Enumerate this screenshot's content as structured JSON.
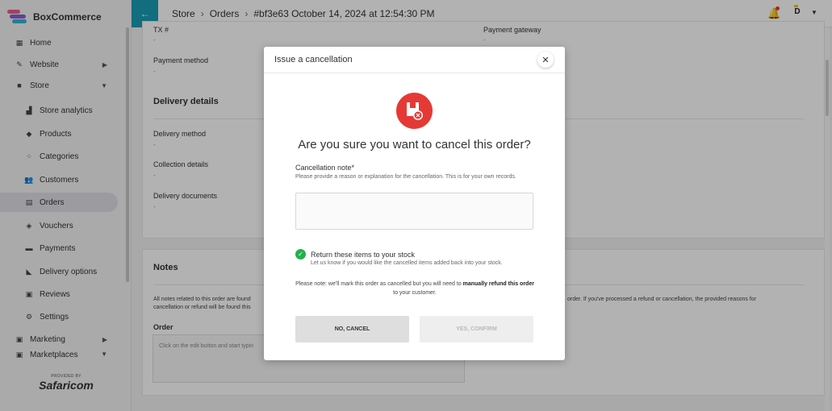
{
  "app": {
    "brand": "BoxCommerce"
  },
  "sidebar": {
    "items": [
      {
        "label": "Home",
        "icon": "grid-icon"
      },
      {
        "label": "Website",
        "icon": "pen-icon"
      },
      {
        "label": "Store",
        "icon": "bag-icon"
      },
      {
        "label": "Store analytics",
        "icon": "chart-icon"
      },
      {
        "label": "Products",
        "icon": "box-icon"
      },
      {
        "label": "Categories",
        "icon": "categories-icon"
      },
      {
        "label": "Customers",
        "icon": "users-icon"
      },
      {
        "label": "Orders",
        "icon": "clipboard-icon"
      },
      {
        "label": "Vouchers",
        "icon": "voucher-icon"
      },
      {
        "label": "Payments",
        "icon": "card-icon"
      },
      {
        "label": "Delivery options",
        "icon": "truck-icon"
      },
      {
        "label": "Reviews",
        "icon": "review-icon"
      },
      {
        "label": "Settings",
        "icon": "settings-icon"
      },
      {
        "label": "Marketing",
        "icon": "marketing-icon"
      },
      {
        "label": "Marketplaces",
        "icon": "marketplace-icon"
      }
    ],
    "provided_by": "PROVIDED BY",
    "partner": "Safaricom"
  },
  "topbar": {
    "breadcrumbs": [
      "Store",
      "Orders",
      "#bf3e63 October 14, 2024 at 12:54:30 PM"
    ],
    "avatar_initial": "D"
  },
  "order": {
    "tx_label": "TX #",
    "tx_value": "-",
    "gateway_label": "Payment gateway",
    "gateway_value": "-",
    "payment_method_label": "Payment method",
    "payment_method_value": "-",
    "delivery_title": "Delivery details",
    "delivery_method_label": "Delivery method",
    "delivery_method_value": "-",
    "collection_label": "Collection details",
    "collection_value": "-",
    "documents_label": "Delivery documents",
    "documents_value": "-",
    "notes_title": "Notes",
    "notes_desc_left": "All notes related to this order are found",
    "notes_desc_left2": "cancellation or refund will be found this",
    "notes_desc_right": "order. If you've processed a refund or cancellation, the provided reasons for",
    "order_label": "Order",
    "order_placeholder": "Click on the edit button and start typin"
  },
  "modal": {
    "title": "Issue a cancellation",
    "question": "Are you sure you want to cancel this order?",
    "note_label": "Cancellation note*",
    "note_help": "Please provide a reason or explanation for the cancellation. This is for your own records.",
    "return_label": "Return these items to your stock",
    "return_help": "Let us know if you would like the cancelled items added back into your stock.",
    "pnote_1": "Please note: we'll mark this order as cancelled but you will need to",
    "pnote_bold": "manually refund this order",
    "pnote_2": "to your customer.",
    "no_label": "NO, CANCEL",
    "yes_label": "YES, CONFIRM"
  },
  "colors": {
    "accent": "#1b9db5",
    "danger": "#e53935",
    "success": "#22b14c"
  }
}
